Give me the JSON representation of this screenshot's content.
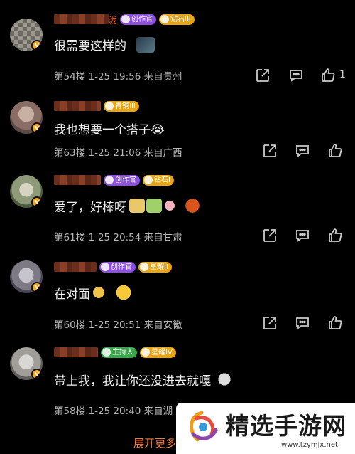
{
  "comments": [
    {
      "name_suffix": "泷",
      "badges": [
        {
          "text": "创作官",
          "color": "purple"
        },
        {
          "text": "钻石III",
          "color": "gold"
        }
      ],
      "text": "很需要这样的",
      "floor": "第54楼",
      "date": "1-25 19:56",
      "location": "来自贵州",
      "likes": "1"
    },
    {
      "name_suffix": "",
      "badges": [
        {
          "text": "青铜III",
          "color": "gold"
        }
      ],
      "text": "我也想要一个搭子😭",
      "floor": "第63楼",
      "date": "1-25 21:06",
      "location": "来自广西",
      "likes": ""
    },
    {
      "name_suffix": "",
      "badges": [
        {
          "text": "创作官",
          "color": "purple"
        },
        {
          "text": "钻石I",
          "color": "gold"
        }
      ],
      "text": "爱了，好棒呀",
      "floor": "第61楼",
      "date": "1-25 20:54",
      "location": "来自甘肃",
      "likes": ""
    },
    {
      "name_suffix": "",
      "badges": [
        {
          "text": "创作官",
          "color": "purple"
        },
        {
          "text": "星耀II",
          "color": "gold"
        }
      ],
      "text": "在对面",
      "floor": "第60楼",
      "date": "1-25 20:51",
      "location": "来自安徽",
      "likes": ""
    },
    {
      "name_suffix": "",
      "badges": [
        {
          "text": "主持人",
          "color": "green"
        },
        {
          "text": "星耀IV",
          "color": "gold"
        }
      ],
      "text": "带上我，我让你还没进去就嘎",
      "floor": "第58楼",
      "date": "1-25 20:40",
      "location": "来自湖",
      "likes": ""
    }
  ],
  "expand_label": "展开更多",
  "watermark": {
    "title": "精选手游网",
    "url": "www.tzymjx.net"
  },
  "icons": {
    "share": "share-icon",
    "reply": "reply-icon",
    "like": "like-icon"
  },
  "colors": {
    "accent": "#f17a3a",
    "creator_badge": "#8d4fe0",
    "rank_badge": "#e7a516",
    "host_badge": "#3aa84a"
  }
}
